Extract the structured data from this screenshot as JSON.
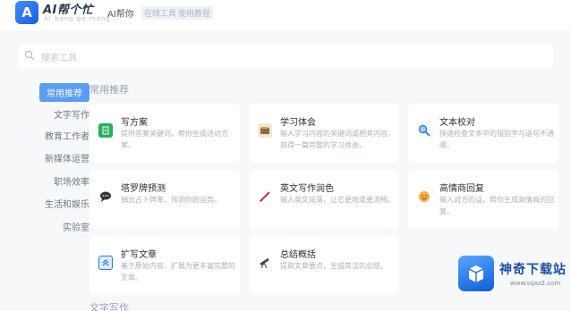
{
  "app": {
    "logo_letter": "A",
    "logo_title": "AI帮个忙",
    "logo_subtitle": "Ai bang ge mang",
    "brand_tag": "AI帮你",
    "top_links": [
      "在线工具",
      "使用教程"
    ]
  },
  "search": {
    "placeholder": "搜索工具"
  },
  "sidebar": {
    "items": [
      {
        "label": "常用推荐",
        "active": true
      },
      {
        "label": "文字写作",
        "active": false
      },
      {
        "label": "教育工作者",
        "active": false
      },
      {
        "label": "新媒体运营",
        "active": false
      },
      {
        "label": "职场效率",
        "active": false
      },
      {
        "label": "生活和娱乐",
        "active": false
      },
      {
        "label": "实验室",
        "active": false
      }
    ]
  },
  "main": {
    "section_title": "常用推荐",
    "section_title_next": "文字写作",
    "cards": [
      {
        "title": "写方案",
        "desc": "提供答案关键词，帮你生成活动方案。",
        "icon": "plan-icon",
        "color": "#27ae60"
      },
      {
        "title": "学习体会",
        "desc": "输入学习内容的关键词或相关内容，获得一篇完整的学习体会。",
        "icon": "book-icon",
        "color": "#8a6d3b"
      },
      {
        "title": "文本校对",
        "desc": "快速检查文本中的错别字与语句不通顺。",
        "icon": "magnifier-icon",
        "color": "#2c7be5"
      },
      {
        "title": "塔罗牌预测",
        "desc": "抽出占卜牌来，预测你的运势。",
        "icon": "speech-icon",
        "color": "#333333"
      },
      {
        "title": "英文写作润色",
        "desc": "输入英文段落，让它更地道更流畅。",
        "icon": "pen-icon",
        "color": "#c0392b"
      },
      {
        "title": "高情商回复",
        "desc": "输入对方的话，帮你生成高情商的回复。",
        "icon": "smile-icon",
        "color": "#e67e22"
      },
      {
        "title": "扩写文章",
        "desc": "基于原始内容，扩展为更丰富完整的文章。",
        "icon": "expand-icon",
        "color": "#2c7be5"
      },
      {
        "title": "总结概括",
        "desc": "提取文章要点，生成简洁的总结。",
        "icon": "telescope-icon",
        "color": "#444444"
      }
    ]
  },
  "watermark": {
    "title": "神奇下载站",
    "url": "www.sqxz2.com"
  }
}
